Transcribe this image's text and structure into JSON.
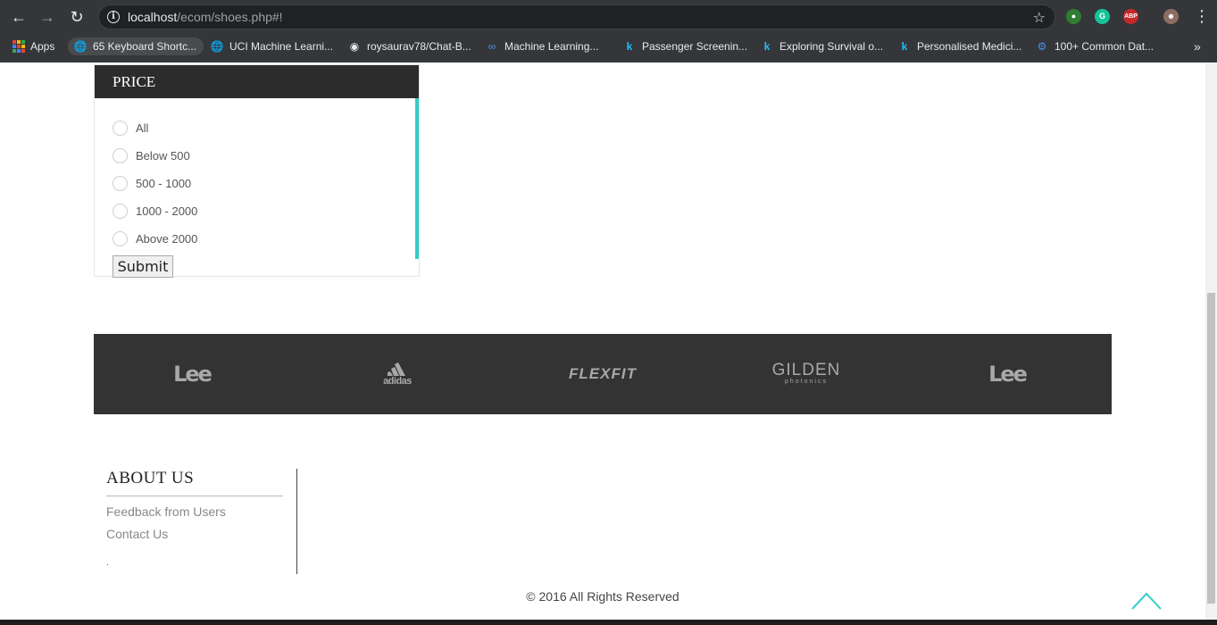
{
  "browser": {
    "url_host": "localhost",
    "url_path": "/ecom/shoes.php#!",
    "bookmarks": [
      {
        "label": "Apps",
        "icon": "apps-grid-icon"
      },
      {
        "label": "65 Keyboard Shortc...",
        "icon": "globe-icon"
      },
      {
        "label": "UCI Machine Learni...",
        "icon": "globe-icon"
      },
      {
        "label": "roysaurav78/Chat-B...",
        "icon": "github-icon"
      },
      {
        "label": "Machine Learning...",
        "icon": "infinity-icon"
      },
      {
        "label": "Passenger Screenin...",
        "icon": "kaggle-icon"
      },
      {
        "label": "Exploring Survival o...",
        "icon": "kaggle-icon"
      },
      {
        "label": "Personalised Medici...",
        "icon": "kaggle-icon"
      },
      {
        "label": "100+ Common Dat...",
        "icon": "gear-icon"
      }
    ],
    "more_bookmarks": "»",
    "extensions": {
      "grammarly": "G",
      "adblock": "ABP"
    }
  },
  "filter": {
    "title": "PRICE",
    "options": [
      "All",
      "Below 500",
      "500 - 1000",
      "1000 - 2000",
      "Above 2000"
    ],
    "submit_label": "Submit"
  },
  "brands": {
    "lee_1": "Lee",
    "adidas": "adidas",
    "flexfit": "FLEXFIT",
    "gilden": "GILDEN",
    "gilden_sub": "photonics",
    "lee_2": "Lee"
  },
  "footer": {
    "about_title": "ABOUT US",
    "links": [
      "Feedback from Users",
      "Contact Us"
    ],
    "dot": ".",
    "copyright": "© 2016 All Rights Reserved"
  },
  "colors": {
    "accent": "#33ccc4",
    "panel_header": "#2c2c2c",
    "brand_strip": "#333333"
  }
}
